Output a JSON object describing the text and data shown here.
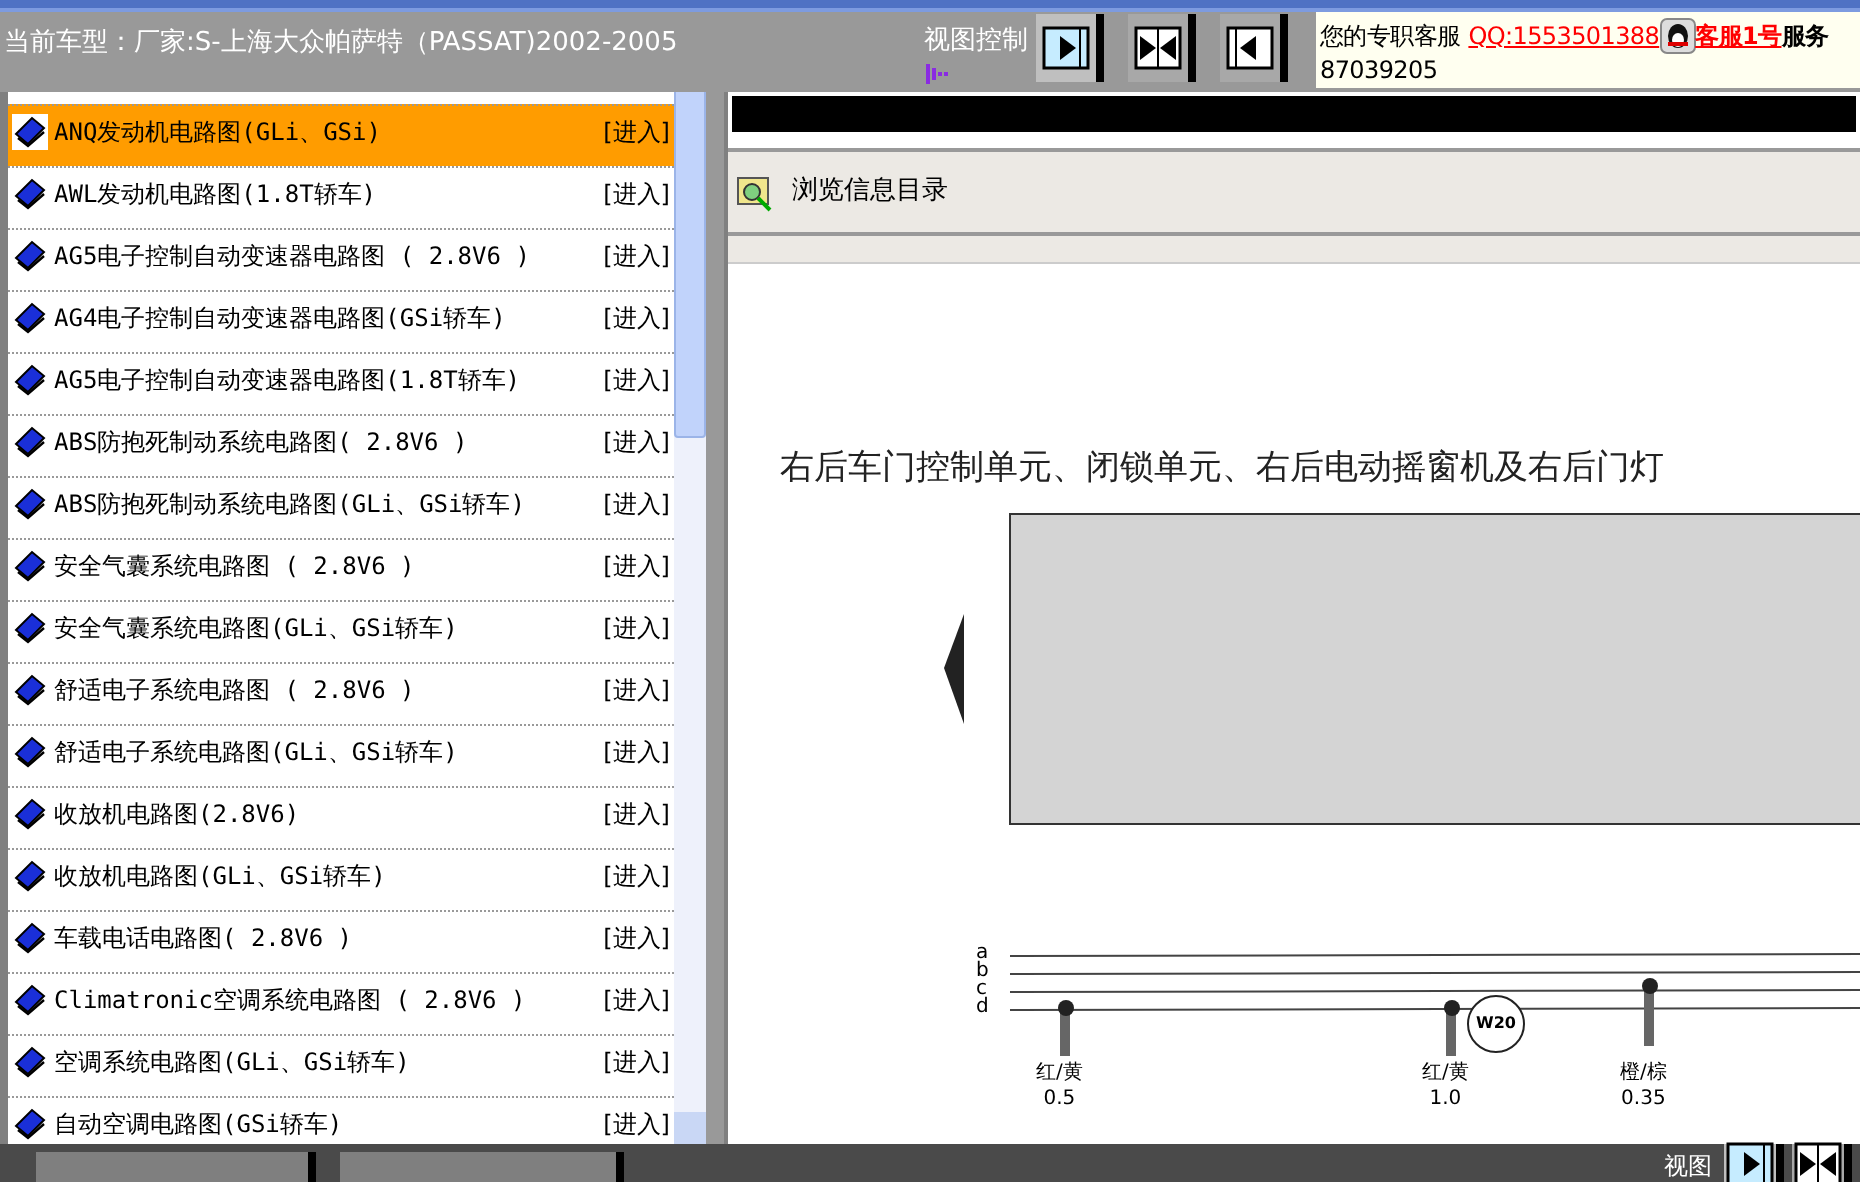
{
  "header": {
    "current_model": "当前车型：厂家:S-上海大众帕萨特（PASSAT)2002-2005",
    "view_control_label": "视图控制",
    "view_buttons": [
      {
        "kind": "right",
        "selected": true
      },
      {
        "kind": "split",
        "selected": false
      },
      {
        "kind": "left",
        "selected": false
      }
    ],
    "service": {
      "text": "您的专职客服",
      "qq": "QQ:1553501388",
      "agent": "客服1号",
      "suffix": "服务",
      "phone": "87039205"
    }
  },
  "list": {
    "items": [
      {
        "title": "ANQ发动机电路图(GLi、GSi)",
        "action": "[进入]",
        "selected": true
      },
      {
        "title": "AWL发动机电路图(1.8T轿车)",
        "action": "[进入]",
        "selected": false
      },
      {
        "title": "AG5电子控制自动变速器电路图 ( 2.8V6 )",
        "action": "[进入]",
        "selected": false
      },
      {
        "title": "AG4电子控制自动变速器电路图(GSi轿车)",
        "action": "[进入]",
        "selected": false
      },
      {
        "title": "AG5电子控制自动变速器电路图(1.8T轿车)",
        "action": "[进入]",
        "selected": false
      },
      {
        "title": "ABS防抱死制动系统电路图( 2.8V6 )",
        "action": "[进入]",
        "selected": false
      },
      {
        "title": "ABS防抱死制动系统电路图(GLi、GSi轿车)",
        "action": "[进入]",
        "selected": false
      },
      {
        "title": "安全气囊系统电路图 ( 2.8V6 )",
        "action": "[进入]",
        "selected": false
      },
      {
        "title": "安全气囊系统电路图(GLi、GSi轿车)",
        "action": "[进入]",
        "selected": false
      },
      {
        "title": "舒适电子系统电路图 ( 2.8V6 )",
        "action": "[进入]",
        "selected": false
      },
      {
        "title": "舒适电子系统电路图(GLi、GSi轿车)",
        "action": "[进入]",
        "selected": false
      },
      {
        "title": "收放机电路图(2.8V6)",
        "action": "[进入]",
        "selected": false
      },
      {
        "title": "收放机电路图(GLi、GSi轿车)",
        "action": "[进入]",
        "selected": false
      },
      {
        "title": "车载电话电路图( 2.8V6 )",
        "action": "[进入]",
        "selected": false
      },
      {
        "title": "Climatronic空调系统电路图 ( 2.8V6 )",
        "action": "[进入]",
        "selected": false
      },
      {
        "title": "空调系统电路图(GLi、GSi轿车)",
        "action": "[进入]",
        "selected": false
      },
      {
        "title": "自动空调电路图(GSi轿车)",
        "action": "[进入]",
        "selected": false
      }
    ]
  },
  "viewer": {
    "toolbar_label": "浏览信息目录",
    "diagram": {
      "title": "右后车门控制单元、闭锁单元、右后电动摇窗机及右后门灯",
      "bus_lines": [
        "a",
        "b",
        "c",
        "d"
      ],
      "connector": "W20",
      "wires": [
        {
          "color_label": "红/黄",
          "size": "0.5"
        },
        {
          "color_label": "红/黄",
          "size": "1.0"
        },
        {
          "color_label": "橙/棕",
          "size": "0.35"
        }
      ]
    }
  },
  "footer": {
    "view_label": "视图"
  }
}
